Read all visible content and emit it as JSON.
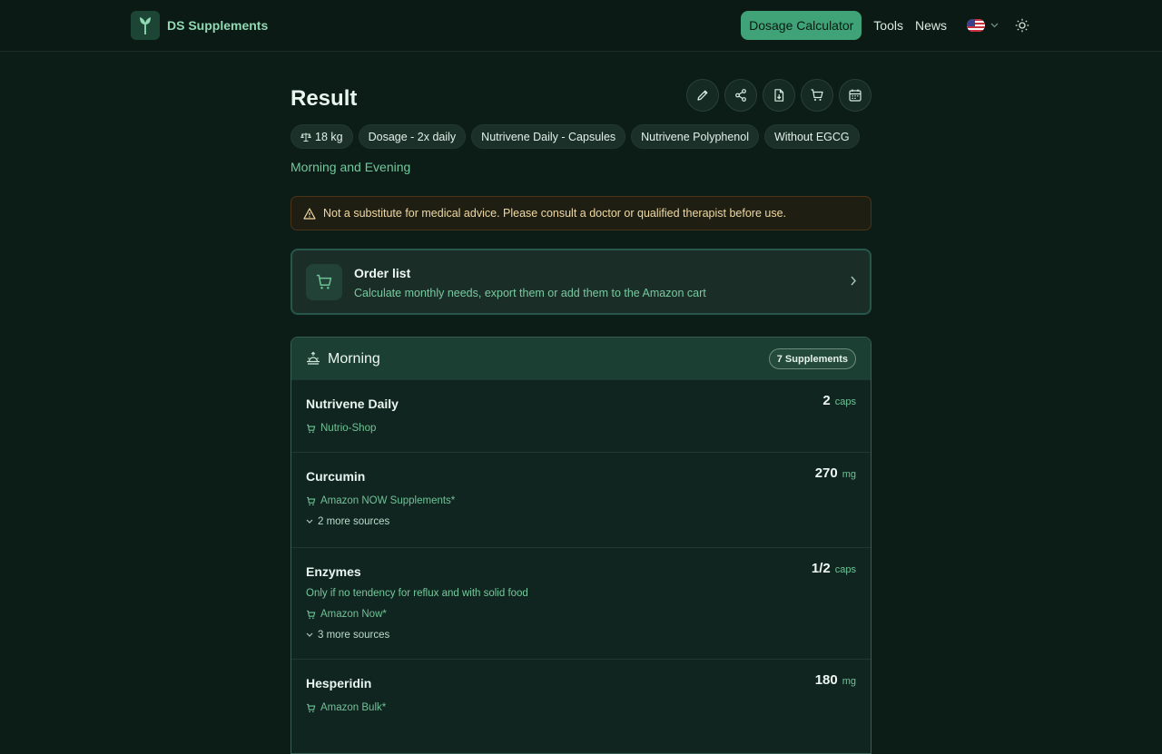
{
  "header": {
    "brand": "DS Supplements",
    "nav": {
      "calculator": "Dosage Calculator",
      "tools": "Tools",
      "news": "News"
    },
    "language_icon": "us-flag-icon",
    "theme_icon": "sun-icon"
  },
  "page": {
    "title": "Result",
    "actions": [
      "pencil-icon",
      "share-icon",
      "file-download-icon",
      "cart-icon",
      "calendar-icon"
    ],
    "tags": {
      "weight": "18 kg",
      "dosage": "Dosage - 2x daily",
      "product": "Nutrivene Daily - Capsules",
      "polyphenol": "Nutrivene Polyphenol",
      "egcg": "Without EGCG"
    },
    "schedule": "Morning and Evening",
    "warning": "Not a substitute for medical advice. Please consult a doctor or qualified therapist before use.",
    "order_list": {
      "title": "Order list",
      "subtitle": "Calculate monthly needs, export them or add them to the Amazon cart"
    },
    "slot": {
      "title": "Morning",
      "badge": "7 Supplements",
      "items": [
        {
          "name": "Nutrivene Daily",
          "amount": "2",
          "unit": "caps",
          "source": "Nutrio-Shop"
        },
        {
          "name": "Curcumin",
          "amount": "270",
          "unit": "mg",
          "source": "Amazon NOW Supplements*",
          "more": "2 more sources"
        },
        {
          "name": "Enzymes",
          "amount": "1/2",
          "unit": "caps",
          "note": "Only if no tendency for reflux and with solid food",
          "source": "Amazon Now*",
          "more": "3 more sources"
        },
        {
          "name": "Hesperidin",
          "amount": "180",
          "unit": "mg",
          "source": "Amazon Bulk*"
        }
      ]
    }
  },
  "colors": {
    "accent": "#3fa377",
    "background": "#0c1c17",
    "warning_border": "#4a3318"
  }
}
